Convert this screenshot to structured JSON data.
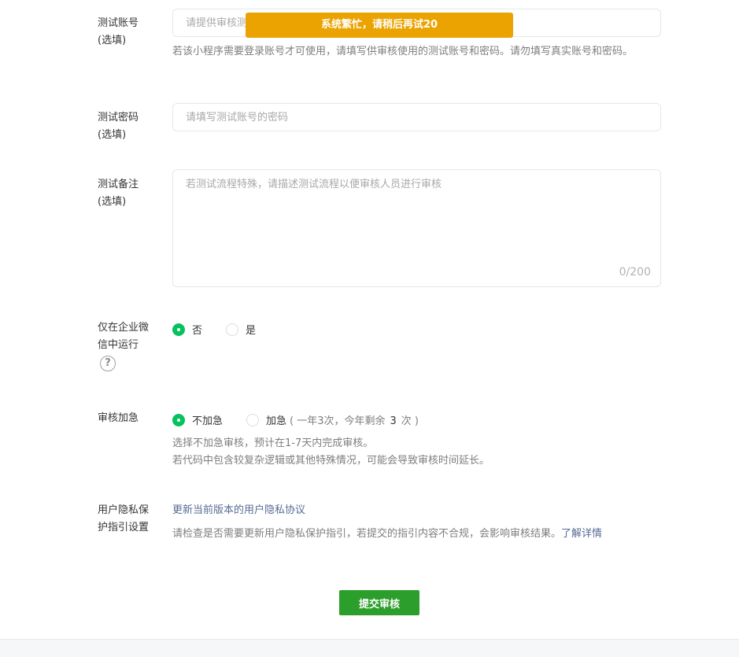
{
  "account": {
    "label_line1": "测试账号",
    "label_line2": "(选填)",
    "placeholder": "请提供审核测试账号",
    "help": "若该小程序需要登录账号才可使用，请填写供审核使用的测试账号和密码。请勿填写真实账号和密码。"
  },
  "toast": {
    "text": "系统繁忙，请稍后再试20"
  },
  "password": {
    "label_line1": "测试密码",
    "label_line2": "(选填)",
    "placeholder": "请填写测试账号的密码"
  },
  "notes": {
    "label_line1": "测试备注",
    "label_line2": "(选填)",
    "placeholder": "若测试流程特殊，请描述测试流程以便审核人员进行审核",
    "counter": "0/200"
  },
  "wework_only": {
    "label_line1": "仅在企业微",
    "label_line2": "信中运行",
    "help_icon": "question-circle-icon",
    "help_glyph": "?",
    "options": [
      {
        "label": "否",
        "checked": true
      },
      {
        "label": "是",
        "checked": false
      }
    ]
  },
  "expedite": {
    "label": "审核加急",
    "options": [
      {
        "label": "不加急",
        "checked": true
      },
      {
        "label": "加急",
        "checked": false
      }
    ],
    "note_prefix": "( 一年3次，今年剩余",
    "remaining": "3",
    "note_suffix": "次 )",
    "help_line1": "选择不加急审核，预计在1-7天内完成审核。",
    "help_line2": "若代码中包含较复杂逻辑或其他特殊情况，可能会导致审核时间延长。"
  },
  "privacy": {
    "label_line1": "用户隐私保",
    "label_line2": "护指引设置",
    "link": "更新当前版本的用户隐私协议",
    "help": "请检查是否需要更新用户隐私保护指引，若提交的指引内容不合规，会影响审核结果。",
    "learn_more": "了解详情"
  },
  "submit": {
    "label": "提交审核"
  },
  "colors": {
    "accent_green": "#07c160",
    "submit_green": "#2c9e2c",
    "toast_orange": "#eaa300",
    "link_blue": "#576b95"
  }
}
